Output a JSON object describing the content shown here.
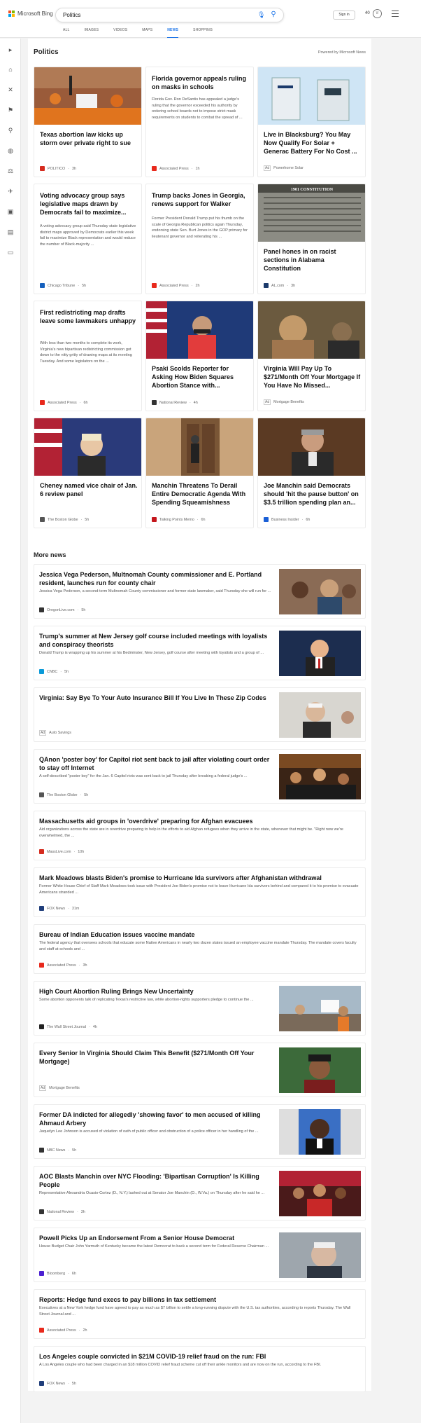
{
  "brand": {
    "name": "Microsoft Bing",
    "colors": [
      "#f25022",
      "#7fba00",
      "#00a4ef",
      "#ffb900"
    ]
  },
  "search": {
    "query": "Politics"
  },
  "header": {
    "signin_label": "Sign in",
    "points": "40"
  },
  "tabs": [
    {
      "label": "ALL"
    },
    {
      "label": "IMAGES"
    },
    {
      "label": "VIDEOS"
    },
    {
      "label": "MAPS"
    },
    {
      "label": "NEWS",
      "active": true
    },
    {
      "label": "SHOPPING"
    }
  ],
  "section": {
    "title": "Politics",
    "powered": "Powered by Microsoft News"
  },
  "cards": [
    {
      "title": "Texas abortion law kicks up storm over private right to sue",
      "snippet": "",
      "source": "POLITICO",
      "time": "3h",
      "ad": false,
      "logo_color": "#d52b1e"
    },
    {
      "title": "Florida governor appeals ruling on masks in schools",
      "snippet": "Florida Gov. Ron DeSantis has appealed a judge's ruling that the governor exceeded his authority by ordering school boards not to impose strict mask requirements on students to combat the spread of ...",
      "source": "Associated Press",
      "time": "1h",
      "ad": false,
      "logo_color": "#e8291c"
    },
    {
      "title": "Live in Blacksburg? You May Now Qualify For Solar + Generac Battery For No Cost ...",
      "snippet": "",
      "source": "Powerhome Solar",
      "time": "",
      "ad": true,
      "logo_color": ""
    },
    {
      "title": "Voting advocacy group says legislative maps drawn by Democrats fail to maximize...",
      "snippet": "A voting advocacy group said Thursday state legislative district maps approved by Democrats earlier this week fail to maximize Black representation and would reduce the number of Black-majority ...",
      "source": "Chicago Tribune",
      "time": "5h",
      "ad": false,
      "logo_color": "#1560bd"
    },
    {
      "title": "Trump backs Jones in Georgia, renews support for Walker",
      "snippet": "Former President Donald Trump put his thumb on the scale of Georgia Republican politics again Thursday, endorsing state Sen. Burt Jones in the GOP primary for lieutenant governor and reiterating his ...",
      "source": "Associated Press",
      "time": "2h",
      "ad": false,
      "logo_color": "#e8291c"
    },
    {
      "title": "Panel hones in on racist sections in Alabama Constitution",
      "snippet": "",
      "source": "AL.com",
      "time": "3h",
      "ad": false,
      "logo_color": "#1b3a6b",
      "caption": "1901 CONSTITUTION"
    },
    {
      "title": "First redistricting map drafts leave some lawmakers unhappy",
      "snippet": "With less than two months to complete its work, Virginia's new bipartisan redistricting commission got down to the nitty gritty of drawing maps at its meeting Tuesday. And some legislators on the ...",
      "source": "Associated Press",
      "time": "6h",
      "ad": false,
      "logo_color": "#e8291c"
    },
    {
      "title": "Psaki Scolds Reporter for Asking How Biden Squares Abortion Stance with...",
      "snippet": "",
      "source": "National Review",
      "time": "4h",
      "ad": false,
      "logo_color": "#333333"
    },
    {
      "title": "Virginia Will Pay Up To $271/Month Off Your Mortgage If You Have No Missed...",
      "snippet": "",
      "source": "Mortgage Benefits",
      "time": "",
      "ad": true,
      "logo_color": ""
    },
    {
      "title": "Cheney named vice chair of Jan. 6 review panel",
      "snippet": "",
      "source": "The Boston Globe",
      "time": "5h",
      "ad": false,
      "logo_color": "#555555"
    },
    {
      "title": "Manchin Threatens To Derail Entire Democratic Agenda With Spending Squeamishness",
      "snippet": "",
      "source": "Talking Points Memo",
      "time": "6h",
      "ad": false,
      "logo_color": "#c4161c"
    },
    {
      "title": "Joe Manchin said Democrats should 'hit the pause button' on $3.5 trillion spending plan an...",
      "snippet": "",
      "source": "Business Insider",
      "time": "6h",
      "ad": false,
      "logo_color": "#1a5fd6"
    }
  ],
  "more_news": {
    "title": "More news",
    "items": [
      {
        "title": "Jessica Vega Pederson, Multnomah County commissioner and E. Portland resident, launches run for county chair",
        "snippet": "Jessica Vega Pederson, a second-term Multnomah County commissioner and former state lawmaker, said Thursday she will run for ...",
        "source": "OregonLive.com",
        "time": "5h",
        "ad": false,
        "logo_color": "#333333",
        "has_image": true
      },
      {
        "title": "Trump's summer at New Jersey golf course included meetings with loyalists and conspiracy theorists",
        "snippet": "Donald Trump is wrapping up his summer at his Bedminster, New Jersey, golf course after meeting with loyalists and a group of ...",
        "source": "CNBC",
        "time": "5h",
        "ad": false,
        "logo_color": "#0a9ad8",
        "has_image": true
      },
      {
        "title": "Virginia: Say Bye To Your Auto Insurance Bill If You Live In These Zip Codes",
        "snippet": "",
        "source": "Auto Savings",
        "time": "",
        "ad": true,
        "logo_color": "",
        "has_image": true
      },
      {
        "title": "QAnon 'poster boy' for Capitol riot sent back to jail after violating court order to stay off Internet",
        "snippet": "A self-described \"poster boy\" for the Jan. 6 Capitol riots was sent back to jail Thursday after breaking a federal judge's ...",
        "source": "The Boston Globe",
        "time": "5h",
        "ad": false,
        "logo_color": "#555555",
        "has_image": true
      },
      {
        "title": "Massachusetts aid groups in 'overdrive' preparing for Afghan evacuees",
        "snippet": "Aid organizations across the state are in overdrive preparing to help in the efforts to aid Afghan refugees when they arrive in the state, whenever that might be. \"Right now we're overwhelmed, the ...",
        "source": "MassLive.com",
        "time": "10h",
        "ad": false,
        "logo_color": "#d52b1e",
        "has_image": false
      },
      {
        "title": "Mark Meadows blasts Biden's promise to Hurricane Ida survivors after Afghanistan withdrawal",
        "snippet": "Former White House Chief of Staff Mark Meadows took issue with President Joe Biden's promise not to leave Hurricane Ida survivors behind and compared it to his promise to evacuate Americans stranded ...",
        "source": "FOX News",
        "time": "31m",
        "ad": false,
        "logo_color": "#1f3d7a",
        "has_image": false
      },
      {
        "title": "Bureau of Indian Education issues vaccine mandate",
        "snippet": "The federal agency that oversees schools that educate some Native Americans in nearly two dozen states issued an employee vaccine mandate Thursday. The mandate covers faculty and staff at schools and ...",
        "source": "Associated Press",
        "time": "3h",
        "ad": false,
        "logo_color": "#e8291c",
        "has_image": false
      },
      {
        "title": "High Court Abortion Ruling Brings New Uncertainty",
        "snippet": "Some abortion opponents talk of replicating Texas's restrictive law, while abortion-rights supporters pledge to continue the ...",
        "source": "The Wall Street Journal",
        "time": "4h",
        "ad": false,
        "logo_color": "#222222",
        "has_image": true
      },
      {
        "title": "Every Senior In Virginia Should Claim This Benefit ($271/Month Off Your Mortgage)",
        "snippet": "",
        "source": "Mortgage Benefits",
        "time": "",
        "ad": true,
        "logo_color": "",
        "has_image": true
      },
      {
        "title": "Former DA indicted for allegedly 'showing favor' to men accused of killing Ahmaud Arbery",
        "snippet": "Jaquelyn Lee Johnson is accused of violation of oath of public officer and obstruction of a police officer in her handling of the ...",
        "source": "NBC News",
        "time": "5h",
        "ad": false,
        "logo_color": "#333333",
        "has_image": true
      },
      {
        "title": "AOC Blasts Manchin over NYC Flooding: 'Bipartisan Corruption' Is Killing People",
        "snippet": "Representative Alexandria Ocasio-Cortez (D., N.Y.) lashed out at Senator Joe Manchin (D., W.Va.) on Thursday after he said he ...",
        "source": "National Review",
        "time": "3h",
        "ad": false,
        "logo_color": "#333333",
        "has_image": true
      },
      {
        "title": "Powell Picks Up an Endorsement From a Senior House Democrat",
        "snippet": "House Budget Chair John Yarmuth of Kentucky became the latest Democrat to back a second term for Federal Reserve Chairman ...",
        "source": "Bloomberg",
        "time": "6h",
        "ad": false,
        "logo_color": "#4b1fd1",
        "has_image": true
      },
      {
        "title": "Reports: Hedge fund execs to pay billions in tax settlement",
        "snippet": "Executives at a New York hedge fund have agreed to pay as much as $7 billion to settle a long-running dispute with the U.S. tax authorities, according to reports Thursday. The Wall Street Journal and ...",
        "source": "Associated Press",
        "time": "2h",
        "ad": false,
        "logo_color": "#e8291c",
        "has_image": false
      },
      {
        "title": "Los Angeles couple convicted in $21M COVID-19 relief fraud on the run: FBI",
        "snippet": "A Los Angeles couple who had been charged in an $18 million COVID relief fraud scheme cut off their ankle monitors and are now on the run, according to the FBI.",
        "source": "FOX News",
        "time": "5h",
        "ad": false,
        "logo_color": "#1f3d7a",
        "has_image": false
      }
    ]
  },
  "ad_label": "Ad"
}
